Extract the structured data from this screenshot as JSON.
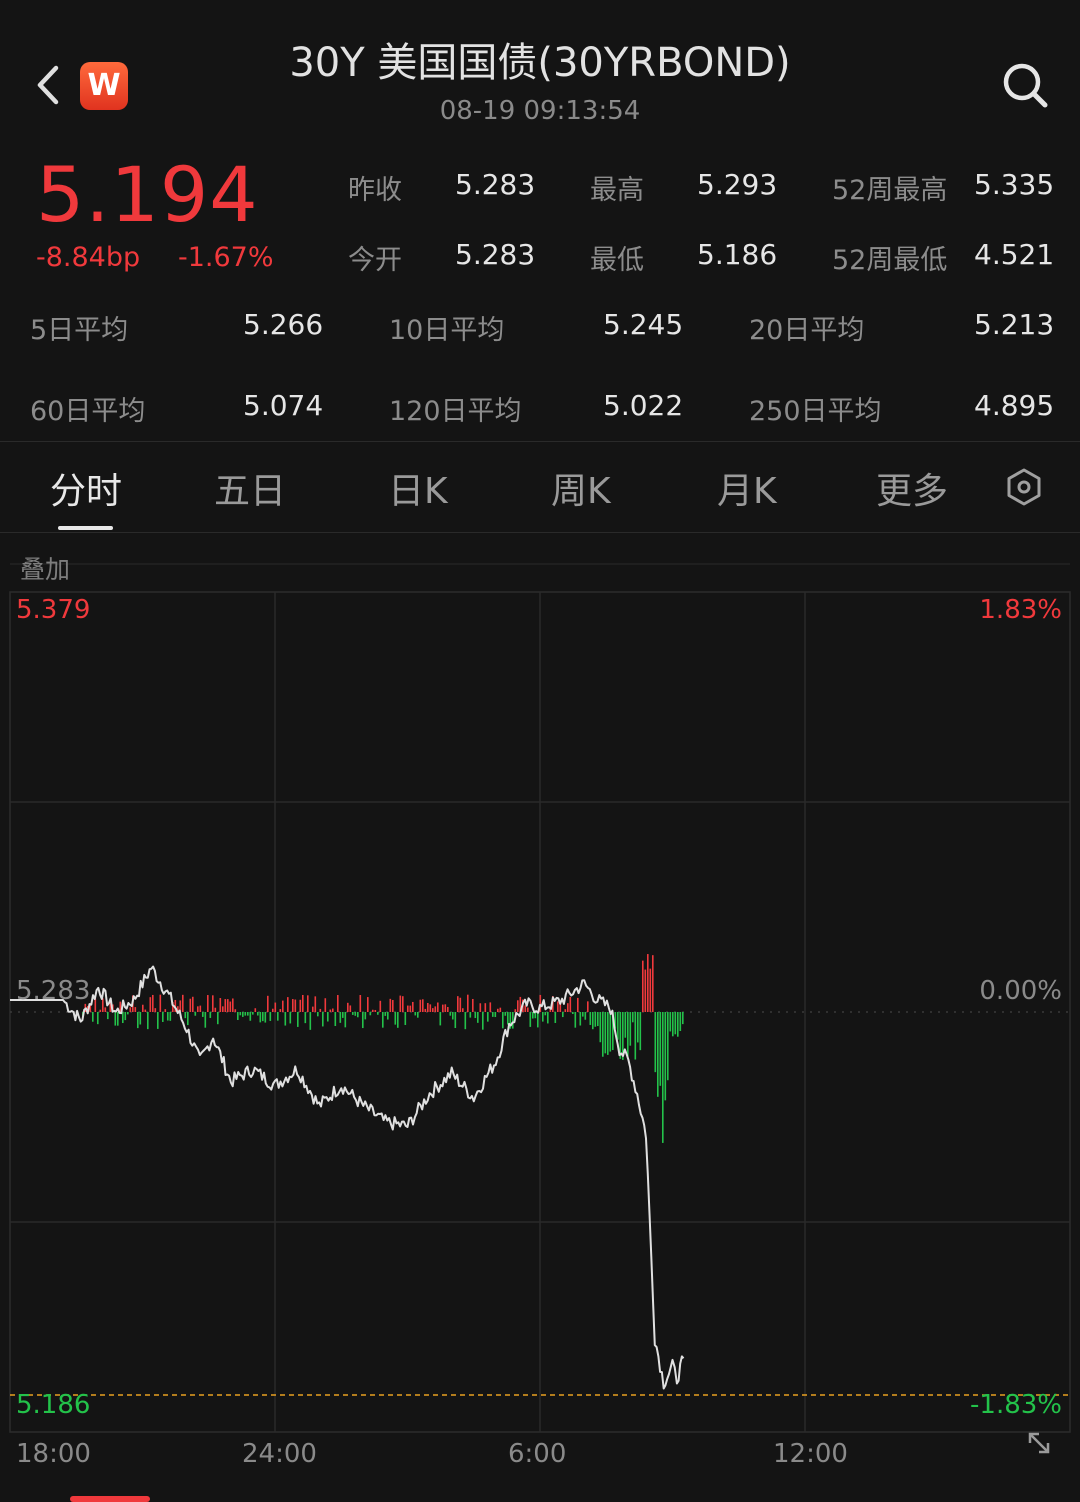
{
  "header": {
    "title": "30Y 美国国债(30YRBOND)",
    "datetime": "08-19 09:13:54",
    "logo_text": "W"
  },
  "quote": {
    "last": "5.194",
    "change_bp": "-8.84bp",
    "change_pct": "-1.67%",
    "stats": [
      {
        "label": "昨收",
        "value": "5.283"
      },
      {
        "label": "最高",
        "value": "5.293"
      },
      {
        "label": "52周最高",
        "value": "5.335"
      },
      {
        "label": "今开",
        "value": "5.283"
      },
      {
        "label": "最低",
        "value": "5.186"
      },
      {
        "label": "52周最低",
        "value": "4.521"
      }
    ],
    "moving_averages": [
      {
        "label": "5日平均",
        "value": "5.266"
      },
      {
        "label": "10日平均",
        "value": "5.245"
      },
      {
        "label": "20日平均",
        "value": "5.213"
      },
      {
        "label": "60日平均",
        "value": "5.074"
      },
      {
        "label": "120日平均",
        "value": "5.022"
      },
      {
        "label": "250日平均",
        "value": "4.895"
      }
    ]
  },
  "tabs": [
    {
      "label": "分时",
      "active": true
    },
    {
      "label": "五日",
      "active": false
    },
    {
      "label": "日K",
      "active": false
    },
    {
      "label": "周K",
      "active": false
    },
    {
      "label": "月K",
      "active": false
    },
    {
      "label": "更多",
      "active": false
    }
  ],
  "chart": {
    "overlay_label": "叠加",
    "y_top_label": "5.379",
    "y_mid_label": "5.283",
    "y_bottom_label": "5.186",
    "pct_top_label": "1.83%",
    "pct_mid_label": "0.00%",
    "pct_bottom_label": "-1.83%",
    "x_labels": [
      "18:00",
      "24:00",
      "6:00",
      "12:00"
    ]
  },
  "colors": {
    "up": "#f0393c",
    "down": "#23c24a",
    "price_line": "#e0e0e0",
    "background": "#141414"
  },
  "chart_data": {
    "type": "line",
    "x_ticks": [
      "18:00",
      "24:00",
      "6:00",
      "12:00"
    ],
    "ylim": [
      5.186,
      5.379
    ],
    "reference": 5.283,
    "series": [
      {
        "x_hours": [
          0,
          1.2,
          1.6,
          2.0,
          2.4,
          2.8,
          3.2,
          3.6,
          4.0,
          4.3,
          4.6,
          5.0,
          5.5,
          6.0,
          6.5,
          7.0,
          7.5,
          8.0,
          8.5,
          9.0,
          9.5,
          10.0,
          10.5,
          11.0,
          11.3,
          11.7,
          12.0,
          12.5,
          13.0,
          13.3,
          13.6,
          13.8,
          14.0,
          14.2,
          14.4,
          14.6,
          14.8,
          15.0,
          15.1,
          15.25
        ],
        "values": [
          5.283,
          5.283,
          5.278,
          5.286,
          5.28,
          5.283,
          5.291,
          5.284,
          5.276,
          5.268,
          5.274,
          5.263,
          5.266,
          5.262,
          5.266,
          5.257,
          5.262,
          5.257,
          5.253,
          5.252,
          5.26,
          5.265,
          5.259,
          5.268,
          5.277,
          5.282,
          5.281,
          5.283,
          5.287,
          5.283,
          5.281,
          5.271,
          5.268,
          5.26,
          5.25,
          5.2,
          5.189,
          5.193,
          5.19,
          5.195
        ]
      }
    ]
  }
}
